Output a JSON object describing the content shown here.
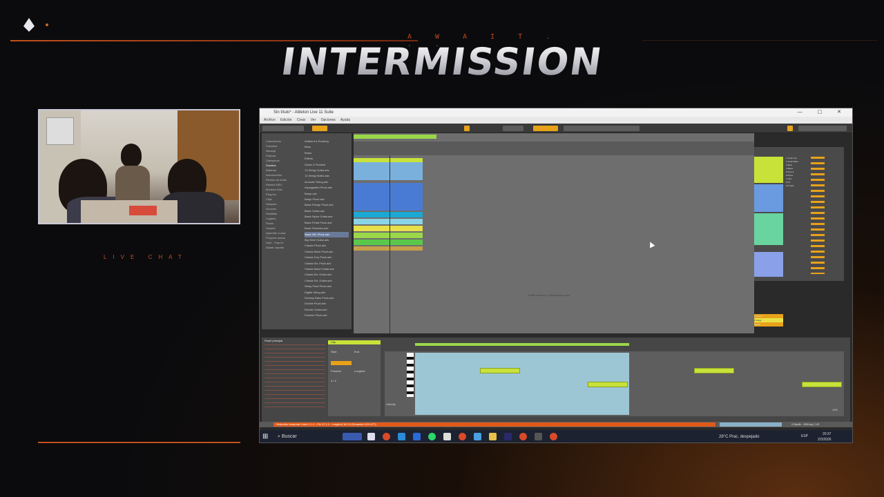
{
  "overlay": {
    "await_text": "A W A I T . . .",
    "title": "INTERMISSION",
    "live_chat": "LIVE CHAT"
  },
  "daw": {
    "window_title": "Sin título* - Ableton Live 11 Suite",
    "window_controls": "— ▢ ✕",
    "menu": "Archivo Edición Crear Ver Opciones Ayuda",
    "browser": {
      "categories": [
        "Colecciones",
        "Favoritos",
        "Naranja",
        "Púrpura",
        "Categorías",
        "Sonidos",
        "Baterías",
        "Instrumentos",
        "Efectos de Audio",
        "Efectos MIDI",
        "Modelos Max",
        "Plug-Ins",
        "Clips",
        "Samples",
        "Grooves",
        "Plantillas",
        "Lugares",
        "Packs",
        "Usuario",
        "Aprender a usar",
        "Proyecto actual",
        "Dark - Trap Dr",
        "Añadir carpeta"
      ],
      "files": [
        "Ambient & Evolving",
        "Bass",
        "Brass",
        "Effects",
        "Guitar & Plucked",
        "12-String Guitar.adv",
        "12-String Muted.adv",
        "Acoustic String.adv",
        "Arpeggiated Pluck.adv",
        "Banjo.adv",
        "Banjo Pluck.adv",
        "Basic Flange Pluck.adv",
        "Basic Guitar.adv",
        "Basic Nylon Guitar.adv",
        "Basic Pedal Pluck.adv",
        "Basic Sheriden.adv",
        "Basic Wir..Pluck.adv",
        "Big Steel Guitar.adv",
        "Classic Pluck.adv",
        "Classic Bass Pluck.adv",
        "Classic Key Pluck.adv",
        "Classic Bri..Pluck.adv",
        "Classic Band Guitar.adv",
        "Classic Bri..Guitar.adv",
        "Classic Dri..Guitar.adv",
        "Delay Feed Pluck.adv",
        "Digital String.adv",
        "Dreamy Bass Pluck.adv",
        "Double Pluck.adv",
        "Electric Guitar.adv",
        "Fashion Pluck.adv"
      ]
    },
    "arrangement_hint": "Suelte archivos y dispositivos aquí",
    "tracks": [
      "1 Synth Arp",
      "2 Synth Bass",
      "3 Bass",
      "4 Bajos",
      "5 Drums",
      "6 Piano",
      "7 Pad",
      "8 FX",
      "10 Audio"
    ],
    "return_tracks": [
      "A Reverb",
      "B Delay",
      "Master"
    ],
    "detail": {
      "clip_name": "Clip",
      "info_title": "Panel principal",
      "loop_start": "Start",
      "loop_end": "End",
      "position": "Posición",
      "length": "Longitud",
      "signature": "4 / 4",
      "velocity": "Velocity",
      "page_indicator": "1/16"
    },
    "status_message": "Selección temporal: Inicio 1.1.1 - Fin 17.1.1 - Longitud 16.0.0 (Duración 0:29.477)",
    "track_status": "2-Synth - 303 Arp | 1/3"
  },
  "taskbar": {
    "search": "Buscar",
    "weather": "28°C Prac. despejado",
    "lang": "ESP",
    "time": "20:37",
    "date": "2/3/2026"
  },
  "colors": {
    "accent": "#c4501c",
    "clip_green": "#c9e23a",
    "clip_blue": "#4a7bd4",
    "clip_cyan": "#1aa8d4",
    "clip_yellow": "#e8e04a"
  }
}
